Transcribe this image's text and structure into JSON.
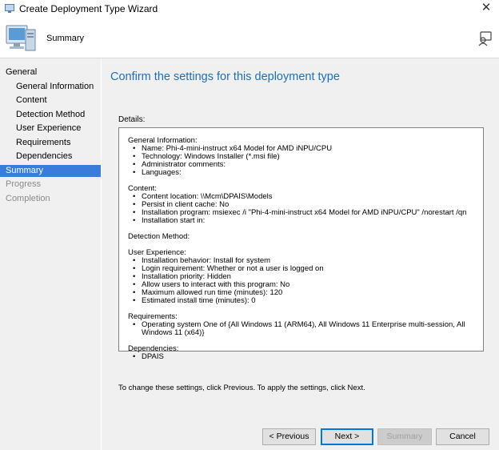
{
  "window": {
    "title": "Create Deployment Type Wizard"
  },
  "header": {
    "step_title": "Summary"
  },
  "sidebar": {
    "items": [
      {
        "label": "General"
      },
      {
        "label": "General Information"
      },
      {
        "label": "Content"
      },
      {
        "label": "Detection Method"
      },
      {
        "label": "User Experience"
      },
      {
        "label": "Requirements"
      },
      {
        "label": "Dependencies"
      },
      {
        "label": "Summary"
      },
      {
        "label": "Progress"
      },
      {
        "label": "Completion"
      }
    ]
  },
  "main": {
    "heading": "Confirm the settings for this deployment type",
    "details_label": "Details:",
    "details": {
      "general": {
        "title": "General Information:",
        "items": [
          "Name: Phi-4-mini-instruct x64 Model for AMD iNPU/CPU",
          "Technology: Windows Installer (*.msi file)",
          "Administrator comments:",
          "Languages:"
        ]
      },
      "content": {
        "title": "Content:",
        "items": [
          "Content location: \\\\Mcm\\DPAIS\\Models",
          "Persist in client cache: No",
          "Installation program: msiexec /i \"Phi-4-mini-instruct x64 Model for AMD iNPU/CPU\" /norestart /qn",
          "Installation start in:"
        ]
      },
      "detection": {
        "title": "Detection Method:"
      },
      "user_experience": {
        "title": "User Experience:",
        "items": [
          "Installation behavior: Install for system",
          "Login requirement: Whether or not a user is logged on",
          "Installation priority: Hidden",
          "Allow users to interact with this program: No",
          "Maximum allowed run time (minutes): 120",
          "Estimated install time (minutes): 0"
        ]
      },
      "requirements": {
        "title": "Requirements:",
        "items": [
          "Operating system  One of  {All Windows 11 (ARM64), All Windows 11 Enterprise multi-session, All Windows 11 (x64)}"
        ]
      },
      "dependencies": {
        "title": "Dependencies:",
        "items": [
          "DPAIS"
        ]
      }
    },
    "instructions": "To change these settings, click Previous. To apply the settings, click Next."
  },
  "buttons": {
    "previous": "< Previous",
    "next": "Next >",
    "summary": "Summary",
    "cancel": "Cancel"
  },
  "colors": {
    "accent": "#3a7cd9",
    "heading": "#1f6fb6",
    "panel": "#f0f0f0"
  },
  "icons": [
    "app-icon",
    "close-icon",
    "computer-icon",
    "help-icon"
  ]
}
